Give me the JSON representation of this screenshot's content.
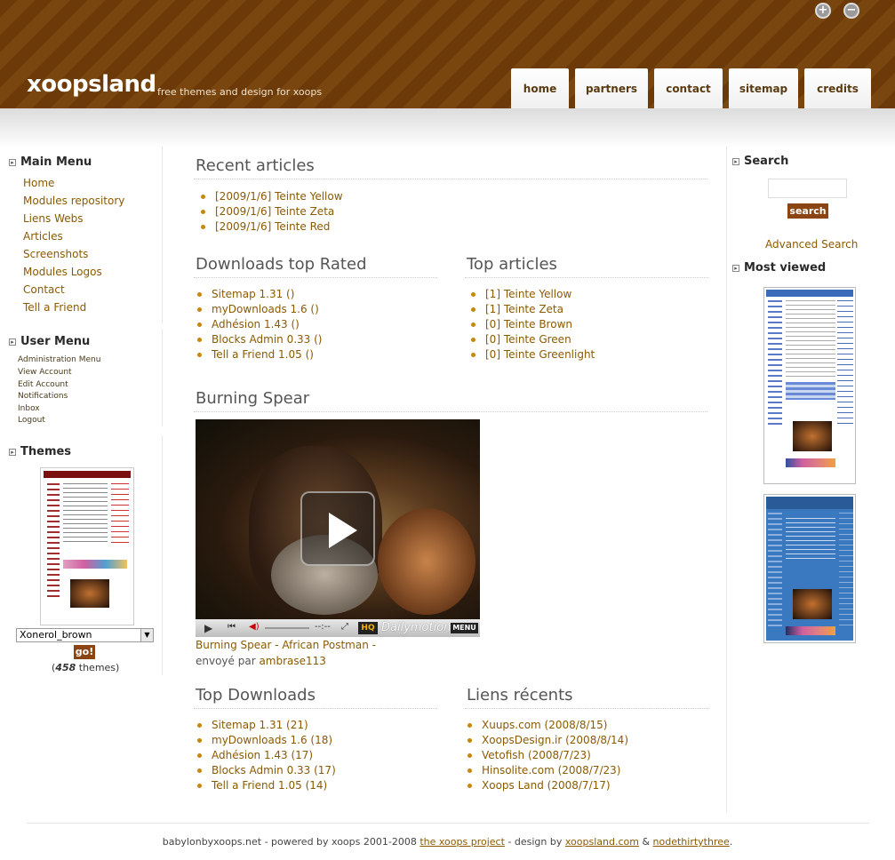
{
  "header": {
    "logo": "xoopsland",
    "tagline": "free themes and design for xoops",
    "zoom_in": "+",
    "zoom_out": "−",
    "tabs": [
      {
        "label": "home"
      },
      {
        "label": "partners"
      },
      {
        "label": "contact"
      },
      {
        "label": "sitemap"
      },
      {
        "label": "credits"
      }
    ]
  },
  "left": {
    "main_menu": {
      "title": "Main Menu",
      "items": [
        "Home",
        "Modules repository",
        "Liens Webs",
        "Articles",
        "Screenshots",
        "Modules Logos",
        "Contact",
        "Tell a Friend"
      ]
    },
    "user_menu": {
      "title": "User Menu",
      "items": [
        "Administration Menu",
        "View Account",
        "Edit Account",
        "Notifications",
        "Inbox",
        "Logout"
      ]
    },
    "themes": {
      "title": "Themes",
      "selected": "Xonerol_brown",
      "go_label": "go!",
      "count_open": "(",
      "count": "458",
      "count_close": " themes)"
    }
  },
  "center": {
    "recent_articles": {
      "title": "Recent articles",
      "items": [
        "[2009/1/6] Teinte Yellow",
        "[2009/1/6] Teinte Zeta",
        "[2009/1/6] Teinte Red"
      ]
    },
    "downloads_top_rated": {
      "title": "Downloads top Rated",
      "items": [
        "Sitemap 1.31 ()",
        "myDownloads 1.6 ()",
        "Adhésion 1.43 ()",
        "Blocks Admin 0.33 ()",
        "Tell a Friend 1.05 ()"
      ]
    },
    "top_articles": {
      "title": "Top articles",
      "items": [
        "[1] Teinte Yellow",
        "[1] Teinte Zeta",
        "[0] Teinte Brown",
        "[0] Teinte Green",
        "[0] Teinte Greenlight"
      ]
    },
    "video": {
      "title": "Burning Spear",
      "time": "--:--",
      "hq": "HQ",
      "brand": "Dailymotion",
      "menu": "MENU",
      "caption": "Burning Spear - African Postman -",
      "sent_by": "envoyé par ",
      "author": "ambrase113"
    },
    "top_downloads": {
      "title": "Top Downloads",
      "items": [
        "Sitemap 1.31 (21)",
        "myDownloads 1.6 (18)",
        "Adhésion 1.43 (17)",
        "Blocks Admin 0.33 (17)",
        "Tell a Friend 1.05 (14)"
      ]
    },
    "liens_recents": {
      "title": "Liens récents",
      "items": [
        "Xuups.com (2008/8/15)",
        "XoopsDesign.ir (2008/8/14)",
        "Vetofish (2008/7/23)",
        "Hinsolite.com (2008/7/23)",
        "Xoops Land (2008/7/17)"
      ]
    }
  },
  "right": {
    "search": {
      "title": "Search",
      "button": "search",
      "advanced": "Advanced Search"
    },
    "most_viewed": {
      "title": "Most viewed"
    }
  },
  "footer": {
    "text_1": "babylonbyxoops.net - powered by xoops 2001-2008 ",
    "link_1": "the xoops project",
    "text_2": " - design by ",
    "link_2": "xoopsland.com",
    "text_3": " & ",
    "link_3": "nodethirtythree",
    "text_4": "."
  },
  "colors": {
    "header_brown": "#6b3a08",
    "link_brown": "#8b5a00",
    "button_brown": "#8b4513"
  }
}
